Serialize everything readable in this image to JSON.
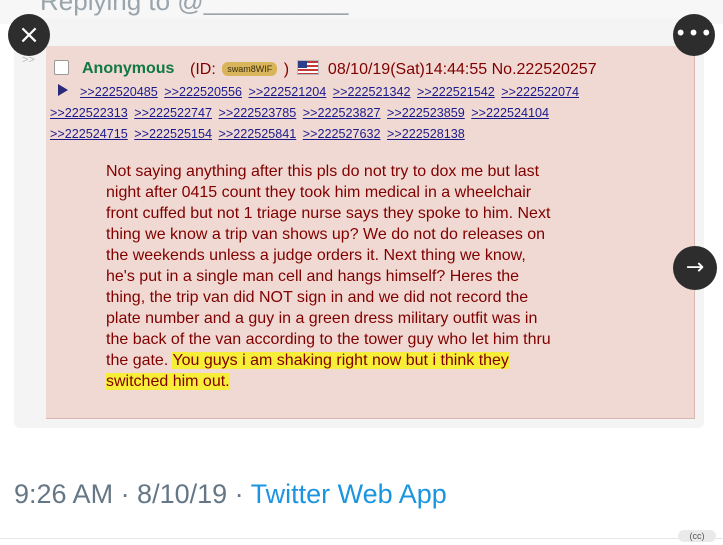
{
  "top": {
    "replying_text": "Replying to @__________"
  },
  "post": {
    "side_marker": ">>",
    "name": "Anonymous",
    "id_prefix": "(ID:",
    "id_value": "swam8WIF",
    "id_suffix": ")",
    "datetime": "08/10/19(Sat)14:44:55",
    "post_number": "No.222520257",
    "replies": [
      [
        ">>222520485",
        ">>222520556",
        ">>222521204",
        ">>222521342",
        ">>222521542",
        ">>222522074"
      ],
      [
        ">>222522313",
        ">>222522747",
        ">>222523785",
        ">>222523827",
        ">>222523859",
        ">>222524104"
      ],
      [
        ">>222524715",
        ">>222525154",
        ">>222525841",
        ">>222527632",
        ">>222528138"
      ]
    ],
    "body_lines": [
      "Not saying anything after this pls do not try to dox me but last",
      "night after 0415 count they took him medical in a wheelchair",
      "front cuffed but not 1 triage nurse says they spoke to him. Next",
      "thing we know a trip van shows up? We do not do releases on",
      "the weekends unless a judge orders it. Next thing we know,",
      "he's put in a single man cell and hangs himself? Heres the",
      "thing, the trip van did NOT sign in and we did not record the",
      "plate number and a guy in a green dress military outfit was in",
      "the back of the van according to the tower guy who let him thru"
    ],
    "line_ten_plain": "the gate. ",
    "line_ten_highlight": "You guys i am shaking right now but i think they",
    "line_eleven_highlight": "switched him out."
  },
  "controls": {
    "close_icon": "×",
    "more_icon": "•••",
    "next_icon": "→"
  },
  "footer": {
    "time_date": "9:26 AM · 8/10/19 · ",
    "app": "Twitter Web App"
  },
  "badge": {
    "cc": "(cc)"
  },
  "colors": {
    "post_bg": "#f0d9d3",
    "name_green": "#117743",
    "text_maroon": "#800000",
    "link_blue": "#1a1a8a",
    "highlight": "#f7ee3a",
    "twitter_blue": "#1b95e0"
  }
}
